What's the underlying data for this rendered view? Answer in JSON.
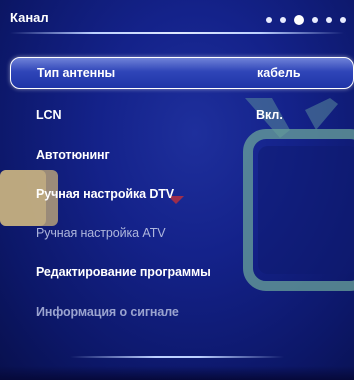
{
  "header": {
    "title": "Канал",
    "page_dots": 6,
    "active_dot": 2
  },
  "menu": {
    "items": [
      {
        "label": "Тип антенны",
        "value": "кабель",
        "state": "selected"
      },
      {
        "label": "LCN",
        "value": "Вкл.",
        "state": "normal"
      },
      {
        "label": "Автотюнинг",
        "value": "",
        "state": "normal"
      },
      {
        "label": "Ручная настройка DTV",
        "value": "",
        "state": "normal"
      },
      {
        "label": "Ручная настройка ATV",
        "value": "",
        "state": "disabled"
      },
      {
        "label": "Редактирование программы",
        "value": "",
        "state": "normal"
      },
      {
        "label": "Информация о сигнале",
        "value": "",
        "state": "disabled"
      }
    ]
  },
  "colors": {
    "background": "#14228a",
    "highlight": "#2f45b8",
    "text": "#ffffff",
    "disabled_text": "#aeb6dc"
  },
  "icons": [
    "tv-decoration-icon"
  ]
}
